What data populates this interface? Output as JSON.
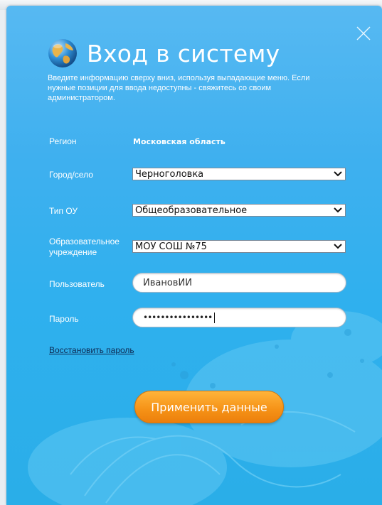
{
  "dialog": {
    "title": "Вход в систему",
    "intro": "Введите информацию сверху вниз, используя выпадающие меню. Если нужные позиции для ввода недоступны - свяжитесь со своим администратором.",
    "close_icon": "close-icon",
    "globe_icon": "globe-icon"
  },
  "form": {
    "region_label": "Регион",
    "region_value": "Московская область",
    "city_label": "Город/село",
    "city_value": "Черноголовка",
    "ou_type_label": "Тип ОУ",
    "ou_type_value": "Общеобразовательное",
    "school_label_1": "Образовательное",
    "school_label_2": "учреждение",
    "school_value": "МОУ СОШ №75",
    "user_label": "Пользователь",
    "user_value": "ИвановИИ",
    "password_label": "Пароль",
    "password_value": "••••••••••••••••",
    "restore_link": "Восстановить пароль",
    "submit_label": "Применить данные"
  },
  "colors": {
    "panel": "#3fb0ef",
    "button": "#f59116",
    "link": "#0d2a52"
  }
}
